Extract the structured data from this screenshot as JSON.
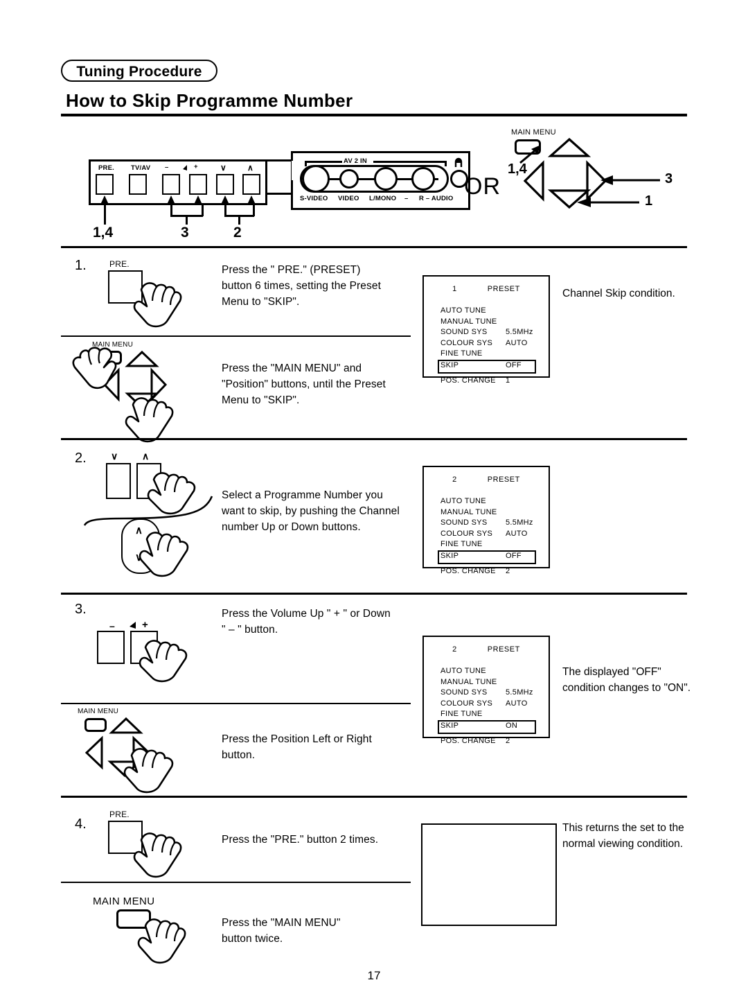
{
  "header": {
    "pill_label": "Tuning Procedure",
    "title": "How to Skip Programme Number"
  },
  "panel_diagram": {
    "button_labels": [
      "PRE.",
      "TV/AV",
      "–",
      "+",
      "∨",
      "∧"
    ],
    "volume_icon": "speaker-icon",
    "av_group_label": "AV 2 IN",
    "jack_labels": [
      "S-VIDEO",
      "VIDEO",
      "L/MONO",
      "–",
      "R – AUDIO"
    ],
    "headphone_icon": "headphone-jack-icon",
    "callouts": [
      "1,4",
      "3",
      "2"
    ]
  },
  "or_cluster": {
    "or_label": "OR",
    "main_menu_label": "MAIN MENU",
    "callout_main_menu": "1,4",
    "callout_right": "3",
    "callout_down": "1"
  },
  "steps": [
    {
      "number": "1.",
      "button_label": "PRE.",
      "text": "Press the \" PRE.\" (PRESET)\nbutton 6 times, setting the Preset\nMenu to \"SKIP\".",
      "sub": {
        "remote_label": "MAIN MENU",
        "text": "Press the \"MAIN MENU\" and\n\"Position\" buttons, until the Preset\nMenu to \"SKIP\"."
      },
      "note": "Channel Skip condition."
    },
    {
      "number": "2.",
      "button_labels": [
        "∨",
        "∧"
      ],
      "rocker_labels": [
        "∧",
        "∨"
      ],
      "text": "Select a Programme Number you\nwant to skip, by pushing the Channel\nnumber Up or Down buttons."
    },
    {
      "number": "3.",
      "button_labels": [
        "–",
        "+"
      ],
      "text": "Press the Volume Up \" + \" or Down\n\" – \" button.",
      "sub": {
        "remote_label": "MAIN MENU",
        "text": "Press the Position Left or Right\nbutton."
      },
      "note": "The displayed \"OFF\"\ncondition changes to \"ON\"."
    },
    {
      "number": "4.",
      "button_label": "PRE.",
      "text": "Press the \"PRE.\" button 2 times.",
      "sub": {
        "remote_label": "MAIN MENU",
        "text": "Press the \"MAIN MENU\"\nbutton twice."
      },
      "note": "This returns the set to the\nnormal viewing condition."
    }
  ],
  "osd_menus": [
    {
      "id": "osd-1",
      "programme": "1",
      "title": "PRESET",
      "rows": [
        {
          "key": "AUTO TUNE",
          "value": "",
          "highlight": false
        },
        {
          "key": "MANUAL TUNE",
          "value": "",
          "highlight": false
        },
        {
          "key": "SOUND SYS",
          "value": "5.5MHz",
          "highlight": false
        },
        {
          "key": "COLOUR SYS",
          "value": "AUTO",
          "highlight": false
        },
        {
          "key": "FINE TUNE",
          "value": "",
          "highlight": false
        },
        {
          "key": "SKIP",
          "value": "OFF",
          "highlight": true
        },
        {
          "key": "POS. CHANGE",
          "value": "1",
          "highlight": false
        }
      ]
    },
    {
      "id": "osd-2",
      "programme": "2",
      "title": "PRESET",
      "rows": [
        {
          "key": "AUTO TUNE",
          "value": "",
          "highlight": false
        },
        {
          "key": "MANUAL TUNE",
          "value": "",
          "highlight": false
        },
        {
          "key": "SOUND SYS",
          "value": "5.5MHz",
          "highlight": false
        },
        {
          "key": "COLOUR SYS",
          "value": "AUTO",
          "highlight": false
        },
        {
          "key": "FINE TUNE",
          "value": "",
          "highlight": false
        },
        {
          "key": "SKIP",
          "value": "OFF",
          "highlight": true
        },
        {
          "key": "POS. CHANGE",
          "value": "2",
          "highlight": false
        }
      ]
    },
    {
      "id": "osd-3",
      "programme": "2",
      "title": "PRESET",
      "rows": [
        {
          "key": "AUTO TUNE",
          "value": "",
          "highlight": false
        },
        {
          "key": "MANUAL TUNE",
          "value": "",
          "highlight": false
        },
        {
          "key": "SOUND SYS",
          "value": "5.5MHz",
          "highlight": false
        },
        {
          "key": "COLOUR SYS",
          "value": "AUTO",
          "highlight": false
        },
        {
          "key": "FINE TUNE",
          "value": "",
          "highlight": false
        },
        {
          "key": "SKIP",
          "value": "ON",
          "highlight": true
        },
        {
          "key": "POS. CHANGE",
          "value": "2",
          "highlight": false
        }
      ]
    }
  ],
  "footer": {
    "page_number": "17"
  }
}
